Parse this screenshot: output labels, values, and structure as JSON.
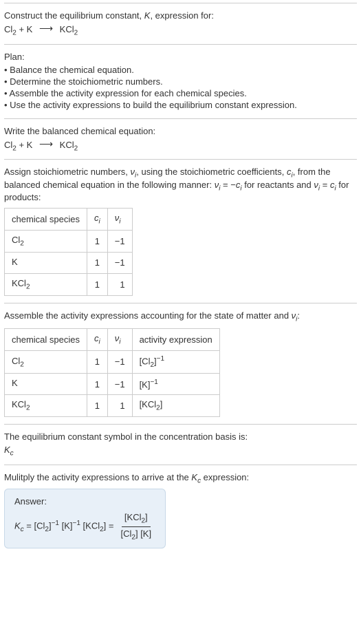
{
  "header": {
    "title_line1": "Construct the equilibrium constant, ",
    "title_K": "K",
    "title_line1_end": ", expression for:"
  },
  "equation": {
    "reactant1": "Cl",
    "reactant1_sub": "2",
    "plus": " + K ",
    "arrow": "⟶",
    "product": " KCl",
    "product_sub": "2"
  },
  "plan": {
    "label": "Plan:",
    "items": [
      "• Balance the chemical equation.",
      "• Determine the stoichiometric numbers.",
      "• Assemble the activity expression for each chemical species.",
      "• Use the activity expressions to build the equilibrium constant expression."
    ]
  },
  "balanced": {
    "intro": "Write the balanced chemical equation:"
  },
  "assign": {
    "p1a": "Assign stoichiometric numbers, ",
    "nu": "ν",
    "sub_i": "i",
    "p1b": ", using the stoichiometric coefficients, ",
    "c": "c",
    "p1c": ", from the balanced chemical equation in the following manner: ",
    "rel_reac": " = −",
    "p1d": " for reactants and ",
    "rel_prod": " = ",
    "p1e": " for products:"
  },
  "table1": {
    "headers": {
      "species": "chemical species",
      "c": "c",
      "nu": "ν",
      "i": "i"
    },
    "rows": [
      {
        "species_a": "Cl",
        "species_sub": "2",
        "c": "1",
        "nu": "−1"
      },
      {
        "species_a": "K",
        "species_sub": "",
        "c": "1",
        "nu": "−1"
      },
      {
        "species_a": "KCl",
        "species_sub": "2",
        "c": "1",
        "nu": "1"
      }
    ]
  },
  "assemble": {
    "p1": "Assemble the activity expressions accounting for the state of matter and ",
    "p2": ":"
  },
  "table2": {
    "headers": {
      "species": "chemical species",
      "activity": "activity expression"
    },
    "rows": [
      {
        "species_a": "Cl",
        "species_sub": "2",
        "c": "1",
        "nu": "−1",
        "act_a": "[Cl",
        "act_sub": "2",
        "act_b": "]",
        "act_exp": "−1"
      },
      {
        "species_a": "K",
        "species_sub": "",
        "c": "1",
        "nu": "−1",
        "act_a": "[K]",
        "act_sub": "",
        "act_b": "",
        "act_exp": "−1"
      },
      {
        "species_a": "KCl",
        "species_sub": "2",
        "c": "1",
        "nu": "1",
        "act_a": "[KCl",
        "act_sub": "2",
        "act_b": "]",
        "act_exp": ""
      }
    ]
  },
  "symbol": {
    "line": "The equilibrium constant symbol in the concentration basis is:",
    "K": "K",
    "c": "c"
  },
  "multiply": {
    "p1": "Mulitply the activity expressions to arrive at the ",
    "p2": " expression:"
  },
  "answer": {
    "label": "Answer:",
    "Kc_K": "K",
    "Kc_c": "c",
    "eq": " = ",
    "t1a": "[Cl",
    "t1sub": "2",
    "t1b": "]",
    "t1exp": "−1",
    "sp": " ",
    "t2a": "[K]",
    "t2exp": "−1",
    "t3a": "[KCl",
    "t3sub": "2",
    "t3b": "]",
    "num_a": "[KCl",
    "num_sub": "2",
    "num_b": "]",
    "den_a": "[Cl",
    "den_sub": "2",
    "den_b": "] [K]"
  }
}
